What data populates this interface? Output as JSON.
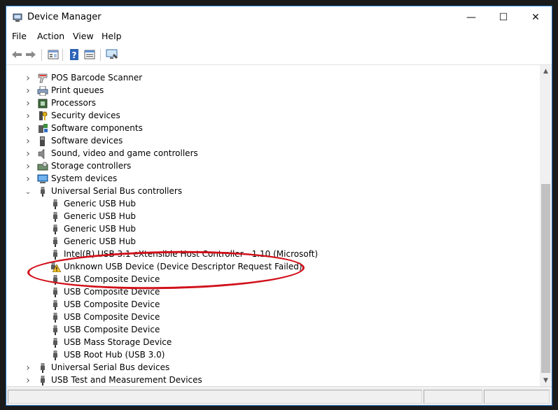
{
  "window": {
    "title": "Device Manager",
    "minimize_glyph": "—",
    "maximize_glyph": "☐",
    "close_glyph": "✕"
  },
  "menu": {
    "items": [
      {
        "name": "menu-file",
        "label": "File"
      },
      {
        "name": "menu-action",
        "label": "Action"
      },
      {
        "name": "menu-view",
        "label": "View"
      },
      {
        "name": "menu-help",
        "label": "Help"
      }
    ]
  },
  "toolbar": {
    "icons": [
      "back-icon",
      "forward-icon",
      "properties-icon",
      "help-icon",
      "update-driver-icon",
      "scan-hardware-icon"
    ]
  },
  "tree": {
    "rows": [
      {
        "label": "POS Barcode Scanner",
        "level": 0,
        "expander": "collapsed",
        "icon": "barcode-scanner-icon"
      },
      {
        "label": "Print queues",
        "level": 0,
        "expander": "collapsed",
        "icon": "printer-icon"
      },
      {
        "label": "Processors",
        "level": 0,
        "expander": "collapsed",
        "icon": "processor-icon"
      },
      {
        "label": "Security devices",
        "level": 0,
        "expander": "collapsed",
        "icon": "security-key-icon"
      },
      {
        "label": "Software components",
        "level": 0,
        "expander": "collapsed",
        "icon": "software-component-icon"
      },
      {
        "label": "Software devices",
        "level": 0,
        "expander": "collapsed",
        "icon": "software-device-icon"
      },
      {
        "label": "Sound, video and game controllers",
        "level": 0,
        "expander": "collapsed",
        "icon": "speaker-icon"
      },
      {
        "label": "Storage controllers",
        "level": 0,
        "expander": "collapsed",
        "icon": "storage-controller-icon"
      },
      {
        "label": "System devices",
        "level": 0,
        "expander": "collapsed",
        "icon": "system-device-icon"
      },
      {
        "label": "Universal Serial Bus controllers",
        "level": 0,
        "expander": "expanded",
        "icon": "usb-plug-icon"
      },
      {
        "label": "Generic USB Hub",
        "level": 1,
        "expander": "none",
        "icon": "usb-plug-icon"
      },
      {
        "label": "Generic USB Hub",
        "level": 1,
        "expander": "none",
        "icon": "usb-plug-icon"
      },
      {
        "label": "Generic USB Hub",
        "level": 1,
        "expander": "none",
        "icon": "usb-plug-icon"
      },
      {
        "label": "Generic USB Hub",
        "level": 1,
        "expander": "none",
        "icon": "usb-plug-icon"
      },
      {
        "label": "Intel(R) USB 3.1 eXtensible Host Controller - 1.10 (Microsoft)",
        "level": 1,
        "expander": "none",
        "icon": "usb-plug-icon"
      },
      {
        "label": "Unknown USB Device (Device Descriptor Request Failed)",
        "level": 1,
        "expander": "none",
        "icon": "warning-icon"
      },
      {
        "label": "USB Composite Device",
        "level": 1,
        "expander": "none",
        "icon": "usb-plug-icon"
      },
      {
        "label": "USB Composite Device",
        "level": 1,
        "expander": "none",
        "icon": "usb-plug-icon"
      },
      {
        "label": "USB Composite Device",
        "level": 1,
        "expander": "none",
        "icon": "usb-plug-icon"
      },
      {
        "label": "USB Composite Device",
        "level": 1,
        "expander": "none",
        "icon": "usb-plug-icon"
      },
      {
        "label": "USB Composite Device",
        "level": 1,
        "expander": "none",
        "icon": "usb-plug-icon"
      },
      {
        "label": "USB Mass Storage Device",
        "level": 1,
        "expander": "none",
        "icon": "usb-plug-icon"
      },
      {
        "label": "USB Root Hub (USB 3.0)",
        "level": 1,
        "expander": "none",
        "icon": "usb-plug-icon"
      },
      {
        "label": "Universal Serial Bus devices",
        "level": 0,
        "expander": "collapsed",
        "icon": "usb-plug-icon"
      },
      {
        "label": "USB Test and Measurement Devices",
        "level": 0,
        "expander": "collapsed",
        "icon": "usb-plug-icon"
      }
    ]
  },
  "annotation": {
    "highlight_color": "#d1101a"
  },
  "colors": {
    "accent": "#1e6fbf",
    "warning": "#f2c12e"
  }
}
